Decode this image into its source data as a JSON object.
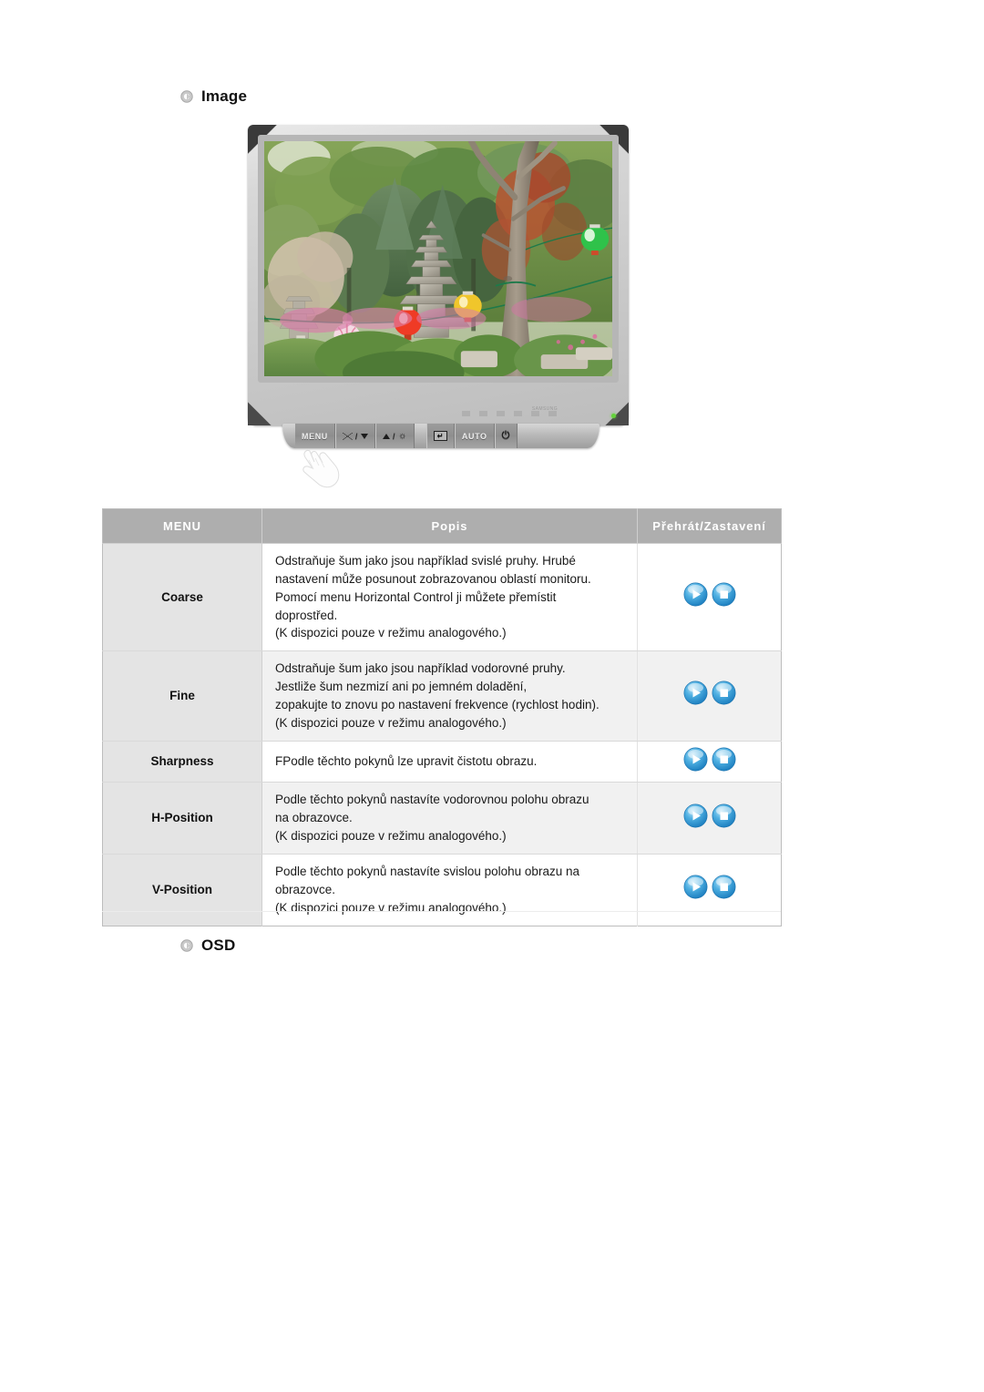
{
  "sections": {
    "image_heading": "Image",
    "osd_heading": "OSD"
  },
  "monitor": {
    "alt": "LCD monitor displaying a photo of a Korean temple garden with a stone pagoda, green trees and colorful paper lanterns",
    "brand_mark": "SAMSUNG",
    "controls": [
      {
        "label": "MENU",
        "icon": "menu-button"
      },
      {
        "label": "",
        "icon": "brightness-down-button",
        "glyph": "mountain-triangle-down"
      },
      {
        "label": "",
        "icon": "brightness-up-button",
        "glyph": "triangle-up-sun"
      },
      {
        "label": "",
        "icon": "enter-source-button",
        "glyph": "enter-arrow"
      },
      {
        "label": "AUTO",
        "icon": "auto-button"
      },
      {
        "label": "",
        "icon": "power-button",
        "glyph": "power-symbol"
      }
    ]
  },
  "table": {
    "headers": [
      "MENU",
      "Popis",
      "Přehrát/Zastavení"
    ],
    "rows": [
      {
        "menu": "Coarse",
        "description": [
          "Odstraňuje šum jako jsou například svislé pruhy. Hrubé",
          "nastavení může posunout zobrazovanou oblastí monitoru.",
          "Pomocí menu Horizontal Control ji můžete přemístit",
          "doprostřed.",
          "(K dispozici pouze v režimu analogového.)"
        ],
        "actions": [
          "play-icon",
          "stop-icon"
        ]
      },
      {
        "menu": "Fine",
        "description": [
          "Odstraňuje šum jako jsou například vodorovné pruhy.",
          "Jestliže šum nezmizí ani po jemném doladění,",
          "zopakujte to znovu po nastavení frekvence (rychlost hodin).",
          "(K dispozici pouze v režimu analogového.)"
        ],
        "actions": [
          "play-icon",
          "stop-icon"
        ]
      },
      {
        "menu": "Sharpness",
        "description": [
          "FPodle těchto pokynů lze upravit čistotu obrazu."
        ],
        "actions": [
          "play-icon",
          "stop-icon"
        ]
      },
      {
        "menu": "H-Position",
        "description": [
          "Podle těchto pokynů nastavíte vodorovnou polohu obrazu",
          "na obrazovce.",
          "(K dispozici pouze v režimu analogového.)"
        ],
        "actions": [
          "play-icon",
          "stop-icon"
        ]
      },
      {
        "menu": "V-Position",
        "description": [
          "Podle těchto pokynů nastavíte svislou polohu obrazu na",
          "obrazovce.",
          "(K dispozici pouze v režimu analogového.)"
        ],
        "actions": [
          "play-icon",
          "stop-icon"
        ]
      }
    ]
  },
  "colors": {
    "header_bg": "#aeaeae",
    "menu_cell_bg": "#e4e4e4",
    "alt_row_bg": "#f1f1f1",
    "orb_blue": "#3fa5dd",
    "led_green": "#63d43a"
  }
}
